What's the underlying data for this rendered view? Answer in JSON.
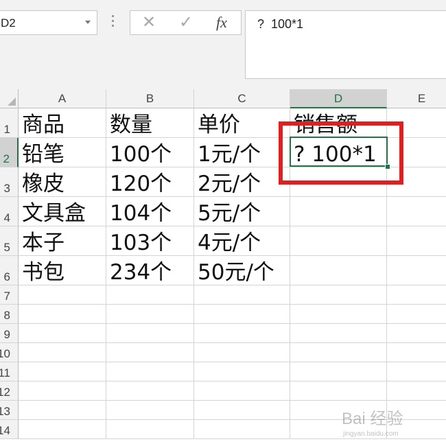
{
  "name_box": {
    "value": "D2"
  },
  "formula_bar": {
    "cancel_glyph": "✕",
    "enter_glyph": "✓",
    "fx_label": "fx",
    "input_value": "?  100*1"
  },
  "columns": [
    "A",
    "B",
    "C",
    "D",
    "E"
  ],
  "selected_column": "D",
  "rows": [
    "1",
    "2",
    "3",
    "4",
    "5",
    "6",
    "7",
    "8",
    "9",
    "10",
    "11",
    "12",
    "13",
    "14"
  ],
  "selected_row": "2",
  "cells": {
    "A1": "商品",
    "B1": "数量",
    "C1": "单价",
    "D1": "销售额",
    "A2": "铅笔",
    "B2": "100个",
    "C2": "1元/个",
    "D2": "?  100*1",
    "A3": "橡皮",
    "B3": "120个",
    "C3": "2元/个",
    "A4": "文具盒",
    "B4": "104个",
    "C4": "5元/个",
    "A5": "本子",
    "B5": "103个",
    "C5": "4元/个",
    "A6": "书包",
    "B6": "234个",
    "C6": "50元/个"
  },
  "active_cell": "D2",
  "accent_color": "#217346",
  "annotation_color": "#e02020",
  "watermark": {
    "brand": "Bai 经验",
    "url": "jingyan.baidu.com"
  }
}
